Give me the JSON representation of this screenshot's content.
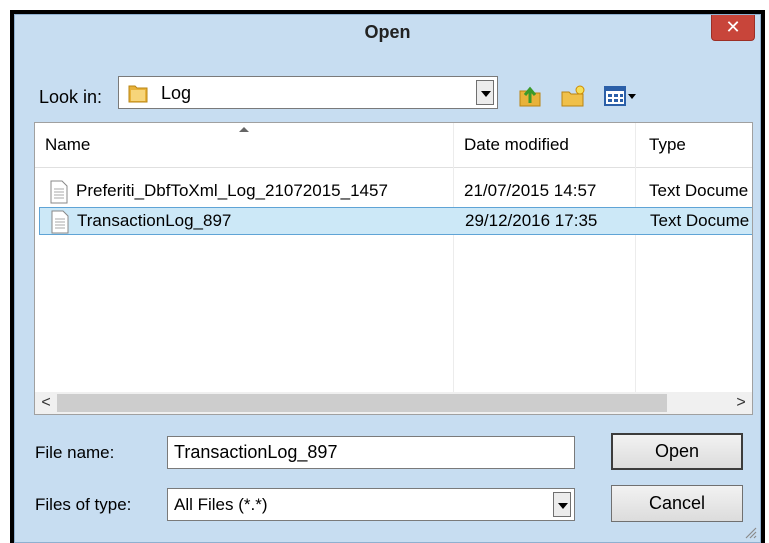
{
  "dialog": {
    "title": "Open",
    "close_symbol": "✕"
  },
  "lookin": {
    "label": "Look in:",
    "value": "Log"
  },
  "toolbar": {
    "icons": [
      "up-folder-icon",
      "new-folder-icon",
      "view-menu-icon"
    ]
  },
  "list": {
    "columns": [
      "Name",
      "Date modified",
      "Type"
    ],
    "rows": [
      {
        "name": "Preferiti_DbfToXml_Log_21072015_1457",
        "date": "21/07/2015 14:57",
        "type": "Text Docume",
        "selected": false
      },
      {
        "name": "TransactionLog_897",
        "date": "29/12/2016 17:35",
        "type": "Text Docume",
        "selected": true
      }
    ],
    "scroll_left": "<",
    "scroll_right": ">"
  },
  "filename": {
    "label": "File name:",
    "value": "TransactionLog_897"
  },
  "filetype": {
    "label": "Files of type:",
    "value": "All Files (*.*)"
  },
  "buttons": {
    "open": "Open",
    "cancel": "Cancel"
  },
  "colors": {
    "frame": "#c7ddf1",
    "selection": "#cce8f7",
    "close": "#c8453a"
  }
}
